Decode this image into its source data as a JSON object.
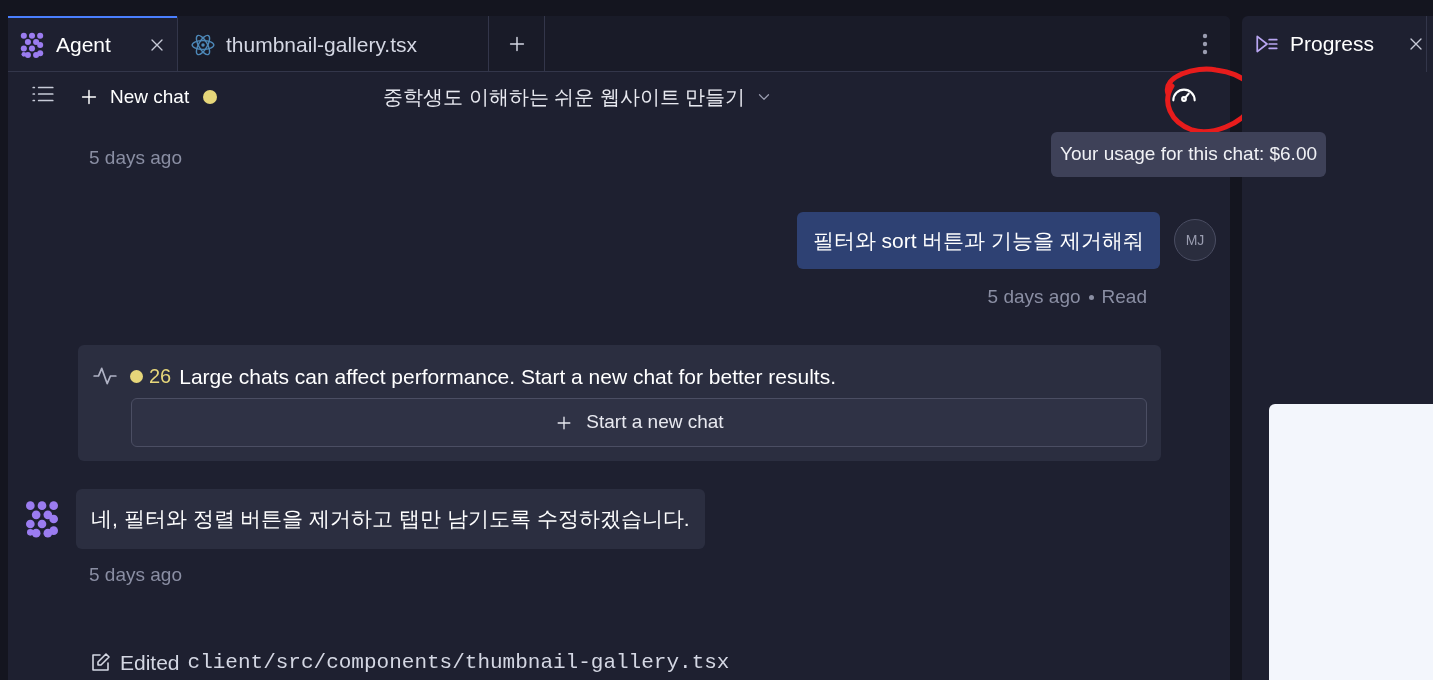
{
  "tabs": [
    {
      "kind": "agent",
      "label": "Agent",
      "selected": true,
      "closable": true
    },
    {
      "kind": "react",
      "label": "thumbnail-gallery.tsx",
      "selected": false,
      "closable": false
    }
  ],
  "side_tab": {
    "label": "Progress"
  },
  "toolbar": {
    "new_chat": "New chat",
    "title": "중학생도 이해하는 쉬운 웹사이트 만들기"
  },
  "tooltip": "Your usage for this chat: $6.00",
  "messages": [
    {
      "kind": "time",
      "time": "5 days ago"
    },
    {
      "kind": "user",
      "text": "필터와 sort 버튼과 기능을 제거해줘",
      "avatar": "MJ",
      "time": "5 days ago",
      "status": "Read"
    },
    {
      "kind": "warning",
      "count": "26",
      "text": "Large chats can affect performance. Start a new chat for better results.",
      "button": "Start a new chat"
    },
    {
      "kind": "agent",
      "text": "네, 필터와 정렬 버튼을 제거하고 탭만 남기도록 수정하겠습니다.",
      "time": "5 days ago"
    },
    {
      "kind": "edit",
      "label": "Edited",
      "path": "client/src/components/thumbnail-gallery.tsx"
    }
  ]
}
